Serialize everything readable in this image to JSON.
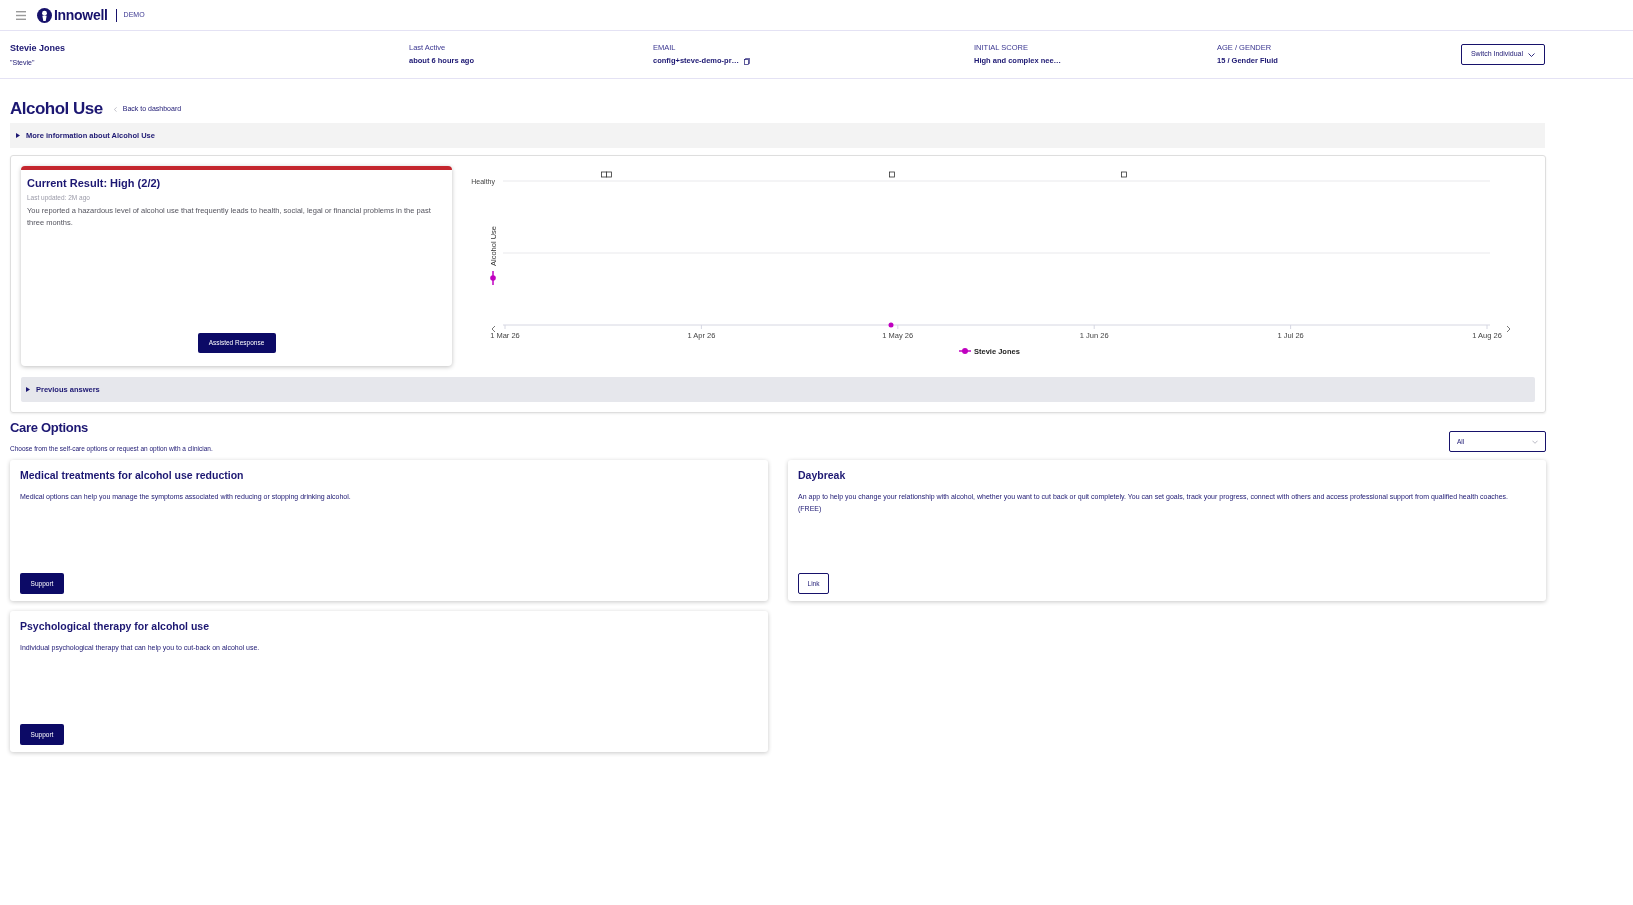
{
  "top_bar": {
    "brand": "Innowell",
    "environment": "DEMO"
  },
  "individual": {
    "name": "Stevie Jones",
    "nickname": "\"Stevie\"",
    "fields": [
      {
        "label": "Last Active",
        "value": "about 6 hours ago",
        "kind": "text"
      },
      {
        "label": "EMAIL",
        "value": "config+steve-demo-pr…",
        "kind": "copy"
      },
      {
        "label": "INITIAL SCORE",
        "value": "High and complex nee…",
        "kind": "text"
      },
      {
        "label": "AGE / GENDER",
        "value": "15 / Gender Fluid",
        "kind": "text"
      }
    ],
    "switch_button": "Switch Individual"
  },
  "page": {
    "title": "Alcohol Use",
    "back_link": "Back to dashboard"
  },
  "more_info": {
    "label": "More information about Alcohol Use",
    "expanded": false
  },
  "result": {
    "title": "Current Result: High (2/2)",
    "updated": "Last updated: 2M ago",
    "description": "You reported a hazardous level of alcohol use that frequently leads to health, social, legal or financial problems in the past three months.",
    "button": "Assisted Response"
  },
  "trend_chart": {
    "y_label": "Alcohol Use",
    "top_label": "Healthy",
    "x_labels": [
      "1 Mar 26",
      "1 Apr 26",
      "1 May 26",
      "1 Jun 26",
      "1 Jul 26",
      "1 Aug 26"
    ],
    "legend": [
      {
        "name": "Stevie Jones",
        "color": "#c000c0"
      }
    ]
  },
  "previous_answers": {
    "label": "Previous answers",
    "expanded": false
  },
  "care_options": {
    "title": "Care Options",
    "subtitle": "Choose from the self-care options or request an option with a clinician.",
    "filter": "All",
    "options": [
      {
        "kind": "support",
        "title": "Medical treatments for alcohol use reduction",
        "description": "Medical options can help you manage the symptoms associated with reducing or stopping drinking alcohol.",
        "button": "Support"
      },
      {
        "kind": "link",
        "title": "Daybreak",
        "description": "An app to help you change your relationship with alcohol, whether you want to cut back or quit completely. You can set goals, track your progress, connect with others and access professional support from qualified health coaches. (FREE)",
        "button": "Link"
      },
      {
        "kind": "support",
        "title": "Psychological therapy for alcohol use",
        "description": "Individual psychological therapy that can help you to cut-back on alcohol use.",
        "button": "Support"
      }
    ]
  }
}
